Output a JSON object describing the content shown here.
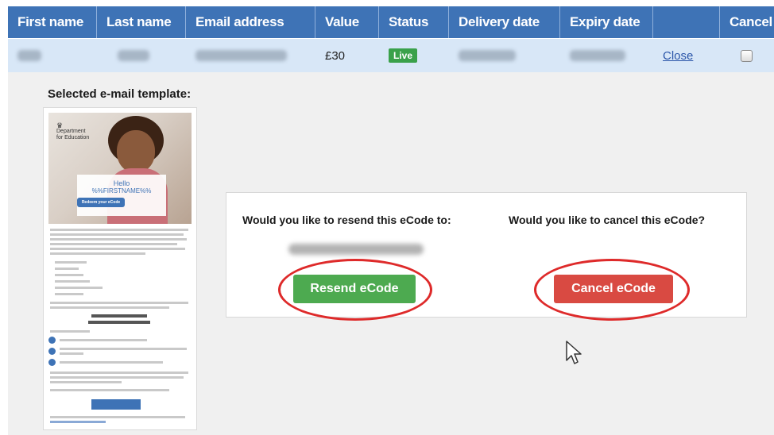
{
  "table": {
    "headers": [
      "First name",
      "Last name",
      "Email address",
      "Value",
      "Status",
      "Delivery date",
      "Expiry date",
      "",
      "Cancel"
    ],
    "row": {
      "value": "£30",
      "status": "Live",
      "action_link": "Close"
    }
  },
  "template_section": {
    "label": "Selected e-mail template:",
    "preview": {
      "org_line1": "Department",
      "org_line2": "for Education",
      "hello": "Hello",
      "name_placeholder": "%%FIRSTNAME%%",
      "button": "Redeem your eCode"
    }
  },
  "dialog": {
    "resend_question": "Would you like to resend this eCode to:",
    "cancel_question": "Would you like to cancel this eCode?",
    "resend_button": "Resend eCode",
    "cancel_button": "Cancel eCode"
  },
  "colors": {
    "header_bg": "#3e73b6",
    "row_bg": "#d8e7f7",
    "resend": "#4daa50",
    "cancel": "#d94a42",
    "highlight_ring": "#de2a2a"
  }
}
